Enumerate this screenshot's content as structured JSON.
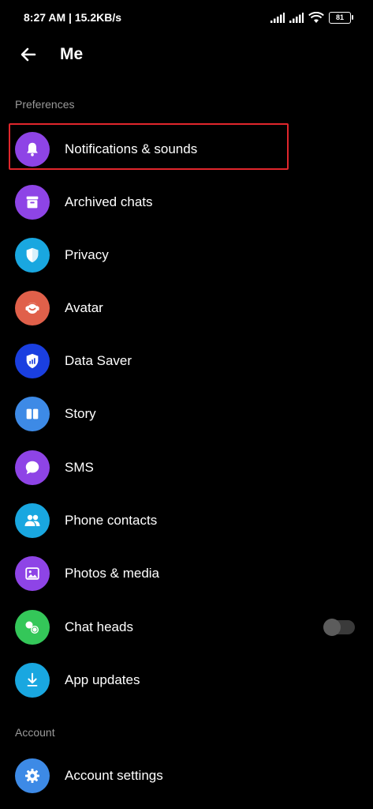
{
  "status": {
    "time_speed": "8:27 AM | 15.2KB/s",
    "battery": "81"
  },
  "header": {
    "title": "Me"
  },
  "sections": {
    "preferences": "Preferences",
    "account": "Account"
  },
  "items": [
    {
      "label": "Notifications & sounds",
      "icon": "bell-icon",
      "color": "#8e44e6"
    },
    {
      "label": "Archived chats",
      "icon": "archive-icon",
      "color": "#8e44e6"
    },
    {
      "label": "Privacy",
      "icon": "shield-icon",
      "color": "#19a7e0"
    },
    {
      "label": "Avatar",
      "icon": "avatar-icon",
      "color": "#e0604a"
    },
    {
      "label": "Data Saver",
      "icon": "data-saver-icon",
      "color": "#1a3fe0"
    },
    {
      "label": "Story",
      "icon": "story-icon",
      "color": "#3d8ae6"
    },
    {
      "label": "SMS",
      "icon": "sms-icon",
      "color": "#8e44e6"
    },
    {
      "label": "Phone contacts",
      "icon": "contacts-icon",
      "color": "#19a7e0"
    },
    {
      "label": "Photos & media",
      "icon": "photo-icon",
      "color": "#8e44e6"
    },
    {
      "label": "Chat heads",
      "icon": "chat-heads-icon",
      "color": "#34c759",
      "toggle": false
    },
    {
      "label": "App updates",
      "icon": "download-icon",
      "color": "#19a7e0"
    },
    {
      "label": "Account settings",
      "icon": "gear-icon",
      "color": "#3d8ae6"
    }
  ]
}
